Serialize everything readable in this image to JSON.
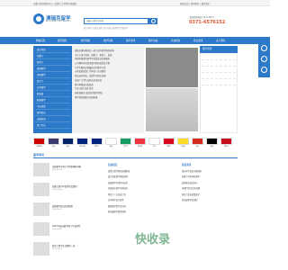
{
  "topbar": {
    "left_text": "加拿大留学服务中心 | 加拿大大学院申请|移民",
    "right_text": "网站首页 | 留学服务 | 联系我们"
  },
  "logo": {
    "name": "澳瑞克留学",
    "tagline": "AUSTRALIA STUDY ABROAD"
  },
  "search": {
    "placeholder": "请输入搜索关键词",
    "hot": "热门搜索: 加拿大留学 澳大利亚 英国留学 美国留学"
  },
  "hotline": {
    "label": "全国咨询热线: 0371-6571",
    "number": "0371-6576152"
  },
  "nav": {
    "items": [
      "网站首页",
      "留学服务",
      "留学国家",
      "留学院校",
      "留学资讯",
      "留学动态",
      "名校招生",
      "签证资讯",
      "关于我们"
    ]
  },
  "sidebar": {
    "items": [
      "澳大利亚",
      "加拿大",
      "新西兰",
      "英国留学",
      "美国留学",
      "爱尔兰",
      "日本留学",
      "新加坡",
      "韩国留学",
      "马来西亚",
      "留学签证",
      "出国培训",
      "热门专业"
    ]
  },
  "banner": {
    "lines": [
      "澳瑞克国际教育是一家专业的留学服务机构",
      "专注于澳大利亚、加拿大、新西兰、英国",
      "美国等国家的留学申请及签证办理服务",
      "公司拥有多名资深留学顾问及签证专家",
      "为学生量身定制最适合的留学方案",
      "从院校选择到入学申请一站式服务",
      "签证成功率高，深受学生家长信赖",
      "欢迎广大学生及家长前来咨询",
      "我们将竭诚为您服务",
      "专业 诚信 高效 务实",
      "选择澳瑞克 成就您的留学梦想",
      "留学咨询请拨打全国热线"
    ]
  },
  "rightcol": {
    "title": "留学资讯"
  },
  "flags": {
    "items": [
      {
        "label": "马来西亚",
        "color": "#cc0001"
      },
      {
        "label": "美国",
        "color": "#3c3b6e"
      },
      {
        "label": "英国",
        "color": "#012169"
      },
      {
        "label": "澳大利亚",
        "color": "#00247d"
      },
      {
        "label": "新西兰",
        "color": "#00247d"
      },
      {
        "label": "韩国",
        "color": "#ffffff"
      },
      {
        "label": "爱尔兰",
        "color": "#169b62"
      },
      {
        "label": "新加坡",
        "color": "#ef3340"
      },
      {
        "label": "日本",
        "color": "#ffffff"
      },
      {
        "label": "加拿大",
        "color": "#d80621"
      },
      {
        "label": "比利时",
        "color": "#fdda24"
      },
      {
        "label": "瑞士",
        "color": "#d52b1e"
      },
      {
        "label": "德国",
        "color": "#000000"
      },
      {
        "label": "西班牙",
        "color": "#c60b1e"
      }
    ]
  },
  "section": {
    "title": "留学资讯"
  },
  "news": [
    {
      "title": "美国留学申请大学需要哪些材料",
      "date": "2023-06-08"
    },
    {
      "title": "加拿大留学申请条件及费用",
      "date": "2023-06-06"
    },
    {
      "title": "英国留学签证办理流程",
      "date": "2023-06-05"
    },
    {
      "title": "2023年澳洲留学热门专业推荐",
      "date": "2023-06-03"
    },
    {
      "title": "新西兰留学生活费用一览",
      "date": "2023-06-01"
    }
  ],
  "midcol": {
    "head": "名校招生",
    "lines": [
      "加拿大留学移民政策解读",
      "澳大利亚留学院校推荐",
      "英国留学申请时间安排",
      "美国高中留学申请指南",
      "新西兰八大名校介绍",
      "日本留学语言要求",
      "韩国留学奖学金申请",
      "新加坡留学费用预算"
    ]
  },
  "rightlist": {
    "head": "签证资讯",
    "lines": [
      "澳洲学生签证办理须知",
      "加拿大学签材料清单",
      "英国签证面试技巧",
      "美国F1签证常见问题",
      "新西兰签证政策变化",
      "签证延期申请流程"
    ]
  },
  "watermark": "快收录"
}
